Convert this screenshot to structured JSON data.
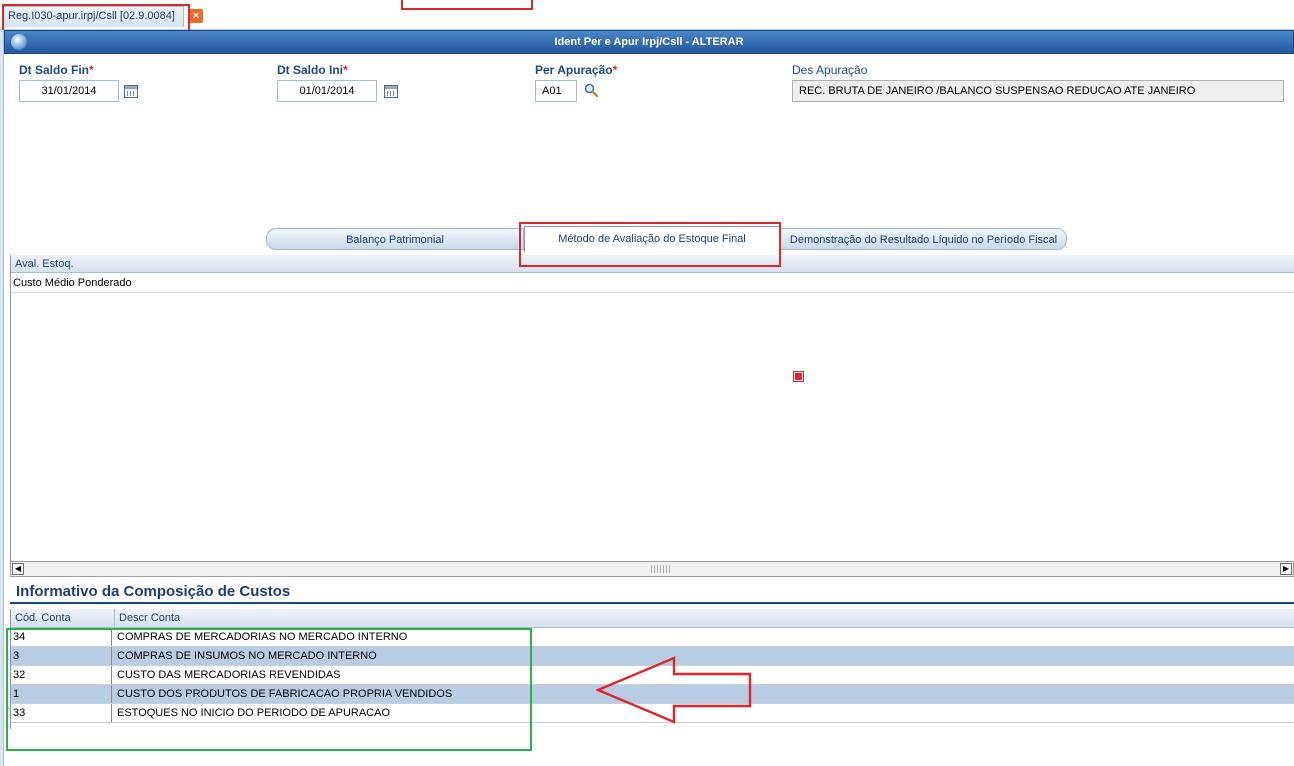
{
  "tab": {
    "label": "Reg.I030-apur.irpj/Csll [02.9.0084]",
    "close_symbol": "×"
  },
  "window": {
    "title": "Ident Per e Apur Irpj/Csll - ALTERAR"
  },
  "form": {
    "dt_saldo_fin": {
      "label": "Dt Saldo Fin",
      "required_mark": "*",
      "value": "31/01/2014"
    },
    "dt_saldo_ini": {
      "label": "Dt Saldo Ini",
      "required_mark": "*",
      "value": "01/01/2014"
    },
    "per_apuracao": {
      "label": "Per Apuração",
      "required_mark": "*",
      "value": "A01"
    },
    "des_apuracao": {
      "label": "Des Apuração",
      "value": "REC. BRUTA DE JANEIRO /BALANCO SUSPENSAO REDUCAO ATE JANEIRO"
    }
  },
  "inner_tabs": [
    {
      "label": "Balanço Patrimonial"
    },
    {
      "label": "Método de Avaliação do Estoque Final",
      "active": true
    },
    {
      "label": "Demonstração do Resultado Líquido no Período Fiscal"
    }
  ],
  "estoque_grid": {
    "header": "Aval. Estoq.",
    "rows": [
      "Custo Médio Ponderado"
    ]
  },
  "scrollbar": {
    "left_arrow": "◀",
    "right_arrow": "▶"
  },
  "custos_section": {
    "title": "Informativo da Composição de Custos",
    "columns": [
      "Cód. Conta",
      "Descr Conta"
    ],
    "rows": [
      {
        "codigo": "34",
        "descricao": "COMPRAS DE MERCADORIAS NO MERCADO INTERNO"
      },
      {
        "codigo": "3",
        "descricao": "COMPRAS DE INSUMOS NO MERCADO INTERNO"
      },
      {
        "codigo": "32",
        "descricao": "CUSTO DAS MERCADORIAS REVENDIDAS"
      },
      {
        "codigo": "1",
        "descricao": "CUSTO DOS PRODUTOS DE FABRICACAO PROPRIA VENDIDOS"
      },
      {
        "codigo": "33",
        "descricao": "ESTOQUES NO INICIO DO PERIODO DE APURACAO"
      }
    ]
  },
  "colors": {
    "title_bar": "#2457a0",
    "label_blue": "#1d4a87",
    "required_red": "#e0262b",
    "alt_row": "#b8cce4",
    "annotation_red": "#e0262b",
    "annotation_green": "#29b34a"
  },
  "icons": [
    "app-icon",
    "close-icon",
    "calendar-icon",
    "search-icon",
    "arrow-annotation"
  ]
}
